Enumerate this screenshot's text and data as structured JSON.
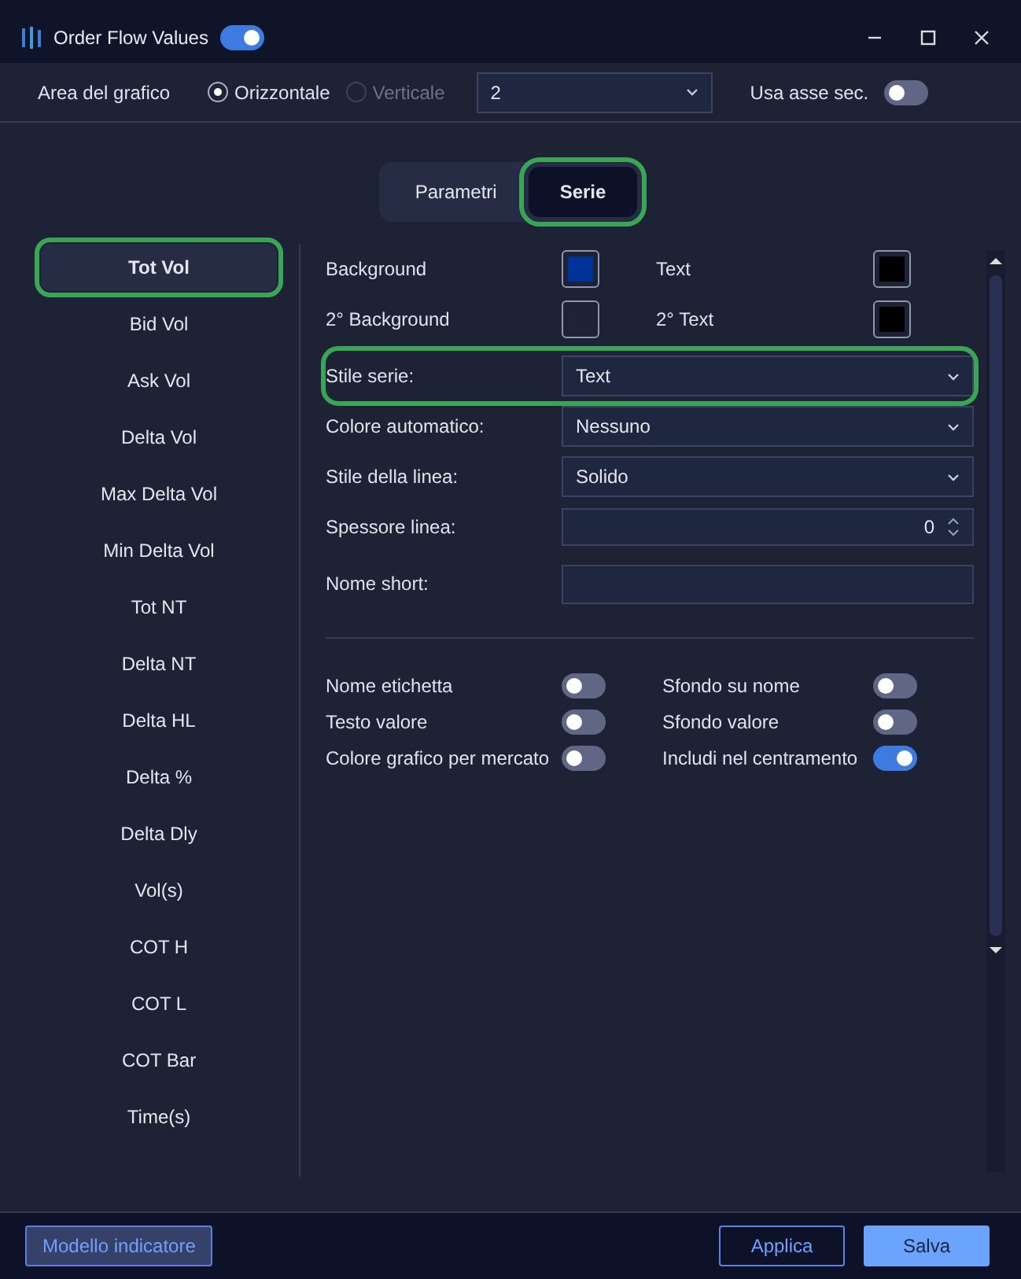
{
  "window": {
    "title": "Order Flow Values",
    "enabled": true
  },
  "toolbar": {
    "area_label": "Area del grafico",
    "orientation": [
      {
        "label": "Orizzontale",
        "selected": true,
        "disabled": false
      },
      {
        "label": "Verticale",
        "selected": false,
        "disabled": true
      }
    ],
    "area_value": "2",
    "secondary_axis": {
      "label": "Usa asse sec.",
      "on": false
    }
  },
  "tabs": [
    {
      "label": "Parametri",
      "selected": false,
      "highlighted": false
    },
    {
      "label": "Serie",
      "selected": true,
      "highlighted": true
    }
  ],
  "sidebar": {
    "items": [
      {
        "label": "Tot Vol",
        "selected": true,
        "highlighted": true
      },
      {
        "label": "Bid Vol",
        "selected": false,
        "highlighted": false
      },
      {
        "label": "Ask Vol",
        "selected": false,
        "highlighted": false
      },
      {
        "label": "Delta Vol",
        "selected": false,
        "highlighted": false
      },
      {
        "label": "Max Delta Vol",
        "selected": false,
        "highlighted": false
      },
      {
        "label": "Min Delta Vol",
        "selected": false,
        "highlighted": false
      },
      {
        "label": "Tot NT",
        "selected": false,
        "highlighted": false
      },
      {
        "label": "Delta NT",
        "selected": false,
        "highlighted": false
      },
      {
        "label": "Delta HL",
        "selected": false,
        "highlighted": false
      },
      {
        "label": "Delta %",
        "selected": false,
        "highlighted": false
      },
      {
        "label": "Delta Dly",
        "selected": false,
        "highlighted": false
      },
      {
        "label": "Vol(s)",
        "selected": false,
        "highlighted": false
      },
      {
        "label": "COT H",
        "selected": false,
        "highlighted": false
      },
      {
        "label": "COT L",
        "selected": false,
        "highlighted": false
      },
      {
        "label": "COT Bar",
        "selected": false,
        "highlighted": false
      },
      {
        "label": "Time(s)",
        "selected": false,
        "highlighted": false
      }
    ]
  },
  "colors": [
    {
      "label": "Background",
      "color": "#003399"
    },
    {
      "label": "Text",
      "color": "#000000"
    },
    {
      "label": "2° Background",
      "color": "#1e2336"
    },
    {
      "label": "2° Text",
      "color": "#000000"
    }
  ],
  "fields": [
    {
      "kind": "select",
      "label": "Stile serie:",
      "value": "Text",
      "highlighted": true
    },
    {
      "kind": "select",
      "label": "Colore automatico:",
      "value": "Nessuno",
      "highlighted": false
    },
    {
      "kind": "select",
      "label": "Stile della linea:",
      "value": "Solido",
      "highlighted": false
    },
    {
      "kind": "number",
      "label": "Spessore linea:",
      "value": "0",
      "highlighted": false
    },
    {
      "kind": "text",
      "label": "Nome short:",
      "highlighted": false
    }
  ],
  "toggles": [
    {
      "label": "Nome etichetta",
      "on": false
    },
    {
      "label": "Sfondo su nome",
      "on": false
    },
    {
      "label": "Testo valore",
      "on": false
    },
    {
      "label": "Sfondo valore",
      "on": false
    },
    {
      "label": "Colore grafico per mercato",
      "on": false
    },
    {
      "label": "Includi nel centramento",
      "on": true
    }
  ],
  "footer": {
    "template_button": "Modello indicatore",
    "apply_button": "Applica",
    "save_button": "Salva"
  }
}
